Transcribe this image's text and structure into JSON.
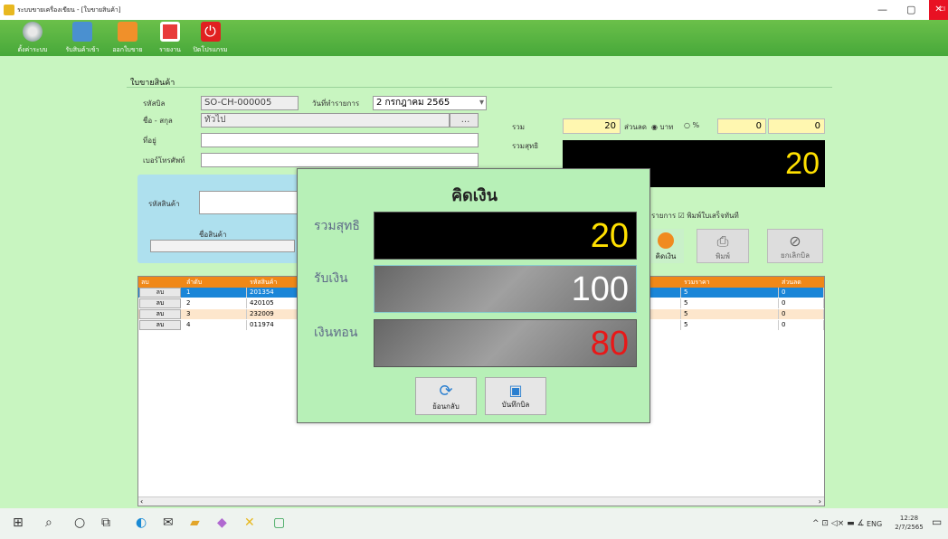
{
  "window": {
    "title": "ระบบขายเครื่องเขียน - [ใบขายสินค้า]",
    "close_label": "Cl"
  },
  "toolbar": [
    "ตั้งค่าระบบ",
    "รับสินค้าเข้า",
    "ออกใบขาย",
    "รายงาน",
    "ปิดโปรแกรม"
  ],
  "form": {
    "section_title": "ใบขายสินค้า",
    "bill_no_label": "รหัสบิล",
    "bill_no": "SO-CH-000005",
    "date_label": "วันที่ทำรายการ",
    "date_value": "2 กรกฎาคม  2565",
    "name_label": "ชื่อ - สกุล",
    "name_value": "ทั่วไป",
    "browse_label": "...",
    "address_label": "ที่อยู่",
    "phone_label": "เบอร์โทรศัพท์",
    "total_label": "รวม",
    "total_value": "20",
    "discount_label": "ส่วนลด",
    "baht_label": "บาท",
    "percent_label": "%",
    "discount_value": "0",
    "discount_total": "0",
    "net_label": "รวมสุทธิ",
    "net_value": "20",
    "product_code_label": "รหัสสินค้า",
    "product_name_label": "ชื่อสินค้า",
    "list_label": "รายการ",
    "print_receipt_label": "พิมพ์ใบเสร็จทันที",
    "pay_btn": "คิดเงิน",
    "print_btn": "พิมพ์",
    "cancel_btn": "ยกเลิกบิล"
  },
  "grid": {
    "headers": [
      "ลบ",
      "ลำดับ",
      "รหัสสินค้า",
      "รวมราคา",
      "ส่วนลด"
    ],
    "rows": [
      [
        "ลบ",
        "1",
        "201354",
        "5",
        "0"
      ],
      [
        "ลบ",
        "2",
        "420105",
        "5",
        "0"
      ],
      [
        "ลบ",
        "3",
        "232009",
        "5",
        "0"
      ],
      [
        "ลบ",
        "4",
        "011974",
        "5",
        "0"
      ]
    ]
  },
  "dialog": {
    "title": "คิดเงิน",
    "net_label": "รวมสุทธิ",
    "net_value": "20",
    "received_label": "รับเงิน",
    "received_value": "100",
    "change_label": "เงินทอน",
    "change_value": "80",
    "back_btn": "ย้อนกลับ",
    "save_btn": "บันทึกบิล"
  },
  "taskbar": {
    "lang": "ENG",
    "time": "12:28",
    "date": "2/7/2565"
  }
}
